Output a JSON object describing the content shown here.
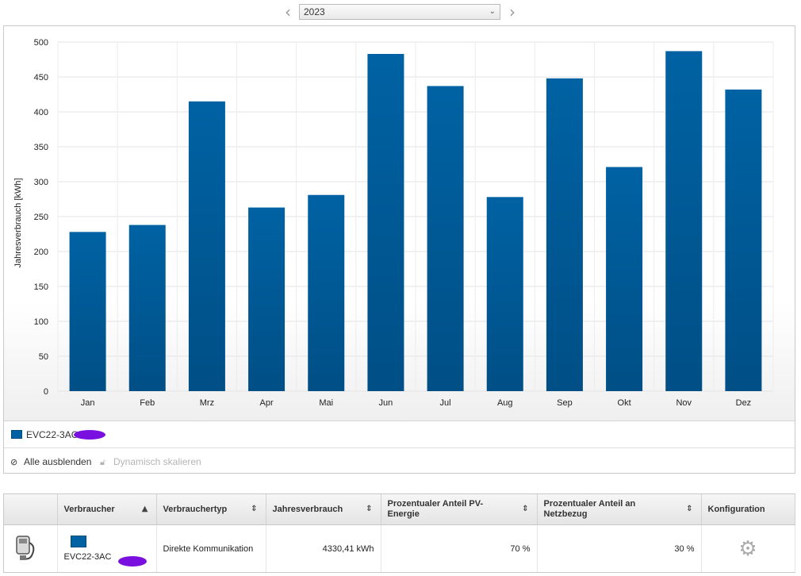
{
  "year_selector": {
    "value": "2023",
    "prev_icon": "chevron-left-icon",
    "next_icon": "chevron-right-icon",
    "caret_icon": "chevron-down-icon"
  },
  "chart_data": {
    "type": "bar",
    "categories": [
      "Jan",
      "Feb",
      "Mrz",
      "Apr",
      "Mai",
      "Jun",
      "Jul",
      "Aug",
      "Sep",
      "Okt",
      "Nov",
      "Dez"
    ],
    "series": [
      {
        "name": "EVC22-3AC",
        "values": [
          228,
          238,
          415,
          263,
          281,
          483,
          437,
          278,
          448,
          321,
          487,
          432
        ],
        "color": "#0062a3"
      }
    ],
    "ylabel": "Jahresverbrauch [kWh]",
    "xlabel": "",
    "ylim": [
      0,
      500
    ],
    "yticks": [
      0,
      50,
      100,
      150,
      200,
      250,
      300,
      350,
      400,
      450,
      500
    ],
    "grid": true,
    "legend": "bottom-left"
  },
  "legend": {
    "label": "EVC22-3AC"
  },
  "tools": {
    "hide_all": "Alle ausblenden",
    "dynamic_scale": "Dynamisch skalieren",
    "hide_icon": "eye-slash-icon",
    "lock_icon": "lock-icon"
  },
  "table": {
    "headers": {
      "consumer": "Verbraucher",
      "type": "Verbrauchertyp",
      "annual": "Jahresverbrauch",
      "pv_share": "Prozentualer Anteil PV-Energie",
      "grid_share": "Prozentualer Anteil an Netzbezug",
      "config": "Konfiguration"
    },
    "rows": [
      {
        "name": "EVC22-3AC",
        "type": "Direkte Kommunikation",
        "annual": "4330,41 kWh",
        "pv_share": "70 %",
        "grid_share": "30 %"
      }
    ],
    "icons": {
      "device": "charging-station-icon",
      "config": "gear-icon",
      "sort_asc": "sort-ascending-icon",
      "sort_both": "sort-icon"
    }
  }
}
